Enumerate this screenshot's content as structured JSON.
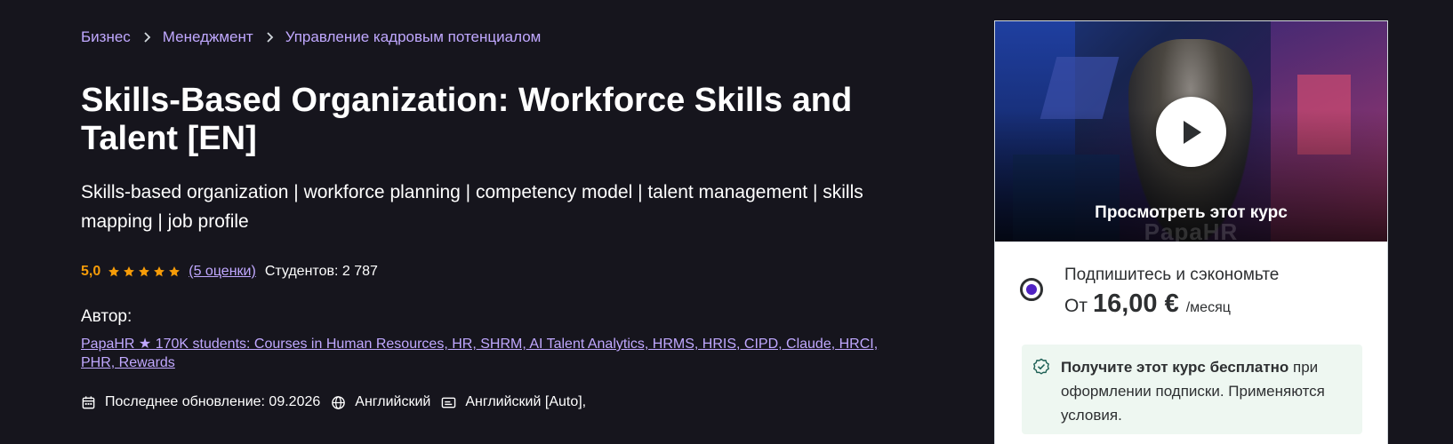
{
  "breadcrumb": {
    "items": [
      "Бизнес",
      "Менеджмент",
      "Управление кадровым потенциалом"
    ]
  },
  "course": {
    "title": "Skills-Based Organization: Workforce Skills and Talent [EN]",
    "subtitle": "Skills-based organization | workforce planning | competency model | talent management | skills mapping | job profile",
    "rating_value": "5,0",
    "rating_stars": 5,
    "rating_count": "(5 оценки)",
    "students": "Студентов: 2 787",
    "author_label": "Автор:",
    "author_link": "PapaHR ★ 170K students: Courses in Human Resources, HR, SHRM, AI Talent Analytics, HRMS, HRIS, CIPD, Claude, HRCI, PHR, Rewards",
    "last_updated": "Последнее обновление: 09.2026",
    "language": "Английский",
    "captions": "Английский [Auto],"
  },
  "card": {
    "preview_label": "Просмотреть этот курс",
    "watermark": "PapaHR",
    "plan_title": "Подпишитесь и сэкономьте",
    "price_from": "От",
    "price_amount": "16,00 €",
    "price_period": "/месяц",
    "promo_bold": "Получите этот курс бесплатно",
    "promo_rest": " при оформлении подписки. Применяются условия."
  },
  "colors": {
    "background": "#16151d",
    "accent_link": "#c0a8ff",
    "rating": "#f69c08",
    "radio_fill": "#5022c3",
    "promo_bg": "#eef7f1"
  },
  "icons": [
    "chevron-right-icon",
    "star-icon",
    "calendar-icon",
    "globe-icon",
    "captions-icon",
    "play-icon",
    "check-badge-icon"
  ]
}
